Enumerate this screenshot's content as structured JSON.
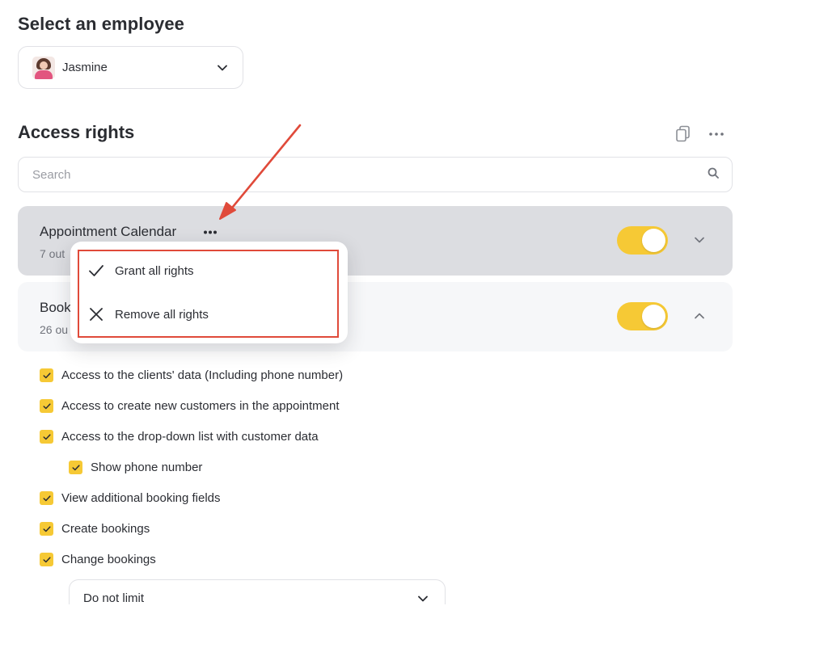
{
  "employee_section": {
    "title": "Select an employee",
    "selected": "Jasmine"
  },
  "access": {
    "title": "Access rights",
    "search_placeholder": "Search",
    "sections": [
      {
        "title": "Appointment Calendar",
        "subtitle": "7 out",
        "toggle_on": true,
        "expanded": false
      },
      {
        "title": "Book",
        "subtitle": "26 ou",
        "toggle_on": true,
        "expanded": true
      }
    ]
  },
  "popup": {
    "items": [
      {
        "label": "Grant all rights",
        "icon": "check-icon"
      },
      {
        "label": "Remove all rights",
        "icon": "close-icon"
      }
    ]
  },
  "permissions": [
    {
      "label": "Access to the clients' data (Including phone number)",
      "checked": true
    },
    {
      "label": "Access to create new customers in the appointment",
      "checked": true
    },
    {
      "label": "Access to the drop-down list with customer data",
      "checked": true
    },
    {
      "label": "Show phone number",
      "checked": true
    },
    {
      "label": "View additional booking fields",
      "checked": true
    },
    {
      "label": "Create bookings",
      "checked": true
    },
    {
      "label": "Change bookings",
      "checked": true
    }
  ],
  "limit_select": {
    "value": "Do not limit"
  },
  "colors": {
    "accent": "#f6c935",
    "annotation": "#e04a3a",
    "active_section": "#dcdde1"
  }
}
